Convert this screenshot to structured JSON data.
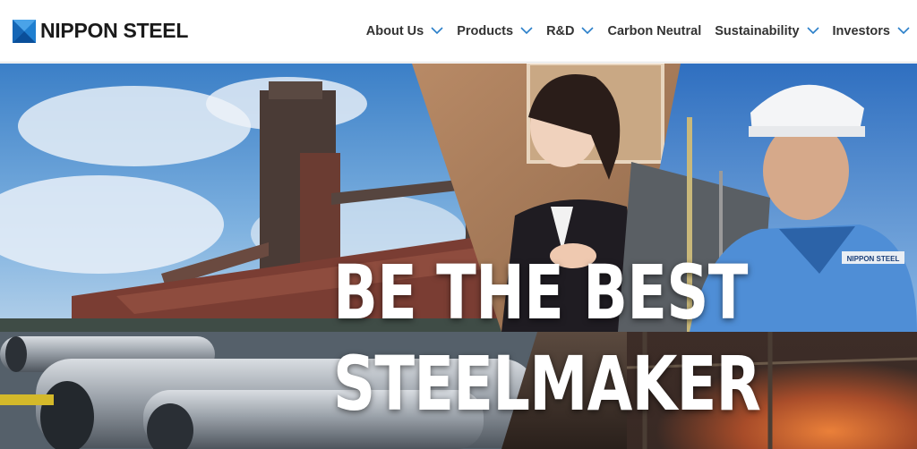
{
  "brand": {
    "name": "NIPPON STEEL",
    "logo_icon": "nippon-steel-logo-mark",
    "colors": {
      "logo_blue": "#1f7fd0",
      "logo_dark": "#0a4f9a",
      "nav_text": "#333333",
      "accent_chevron": "#2a7fc9"
    }
  },
  "nav": {
    "items": [
      {
        "label": "About Us",
        "has_dropdown": true
      },
      {
        "label": "Products",
        "has_dropdown": true
      },
      {
        "label": "R&D",
        "has_dropdown": true
      },
      {
        "label": "Carbon Neutral",
        "has_dropdown": false
      },
      {
        "label": "Sustainability",
        "has_dropdown": true
      },
      {
        "label": "Investors",
        "has_dropdown": true
      }
    ]
  },
  "hero": {
    "tagline_line1": "BE THE BEST",
    "tagline_line2": "STEELMAKER",
    "badge_text": "NIPPON STEEL"
  }
}
